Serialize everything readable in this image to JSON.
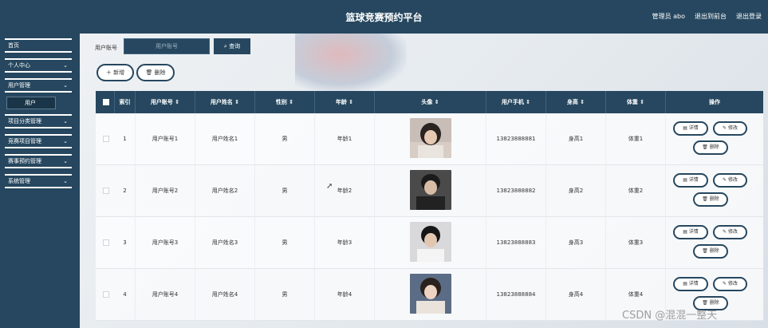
{
  "header": {
    "title": "篮球竞赛预约平台",
    "admin_label": "管理员 abo",
    "back_label": "退出到前台",
    "logout_label": "退出登录"
  },
  "sidebar": {
    "items": [
      {
        "label": "首页",
        "has_chevron": false
      },
      {
        "label": "个人中心",
        "has_chevron": true
      },
      {
        "label": "用户管理",
        "has_chevron": true
      },
      {
        "label": "项目分类管理",
        "has_chevron": true
      },
      {
        "label": "竞赛项目管理",
        "has_chevron": true
      },
      {
        "label": "赛事预约管理",
        "has_chevron": true
      },
      {
        "label": "系统管理",
        "has_chevron": true
      }
    ],
    "active_subitem": "用户"
  },
  "search": {
    "label": "用户账号",
    "placeholder": "用户账号",
    "button_label": "查询"
  },
  "actions": {
    "add_label": "新增",
    "delete_label": "删除"
  },
  "table": {
    "columns": [
      "索引",
      "用户账号",
      "用户姓名",
      "性别",
      "年龄",
      "头像",
      "用户手机",
      "身高",
      "体重",
      "操作"
    ],
    "sort_indicator": "⇕",
    "rows": [
      {
        "index": "1",
        "account": "用户账号1",
        "name": "用户姓名1",
        "gender": "男",
        "age": "年龄1",
        "phone": "13823888881",
        "height": "身高1",
        "weight": "体重1"
      },
      {
        "index": "2",
        "account": "用户账号2",
        "name": "用户姓名2",
        "gender": "男",
        "age": "年龄2",
        "phone": "13823888882",
        "height": "身高2",
        "weight": "体重2"
      },
      {
        "index": "3",
        "account": "用户账号3",
        "name": "用户姓名3",
        "gender": "男",
        "age": "年龄3",
        "phone": "13823888883",
        "height": "身高3",
        "weight": "体重3"
      },
      {
        "index": "4",
        "account": "用户账号4",
        "name": "用户姓名4",
        "gender": "男",
        "age": "年龄4",
        "phone": "13823888884",
        "height": "身高4",
        "weight": "体重4"
      }
    ],
    "row_actions": {
      "detail": "详情",
      "edit": "修改",
      "delete": "删除"
    }
  },
  "watermark": "CSDN @混混一整天",
  "colors": {
    "primary": "#26475f",
    "sidebar": "#26475f",
    "active_sub": "#1a3548"
  }
}
